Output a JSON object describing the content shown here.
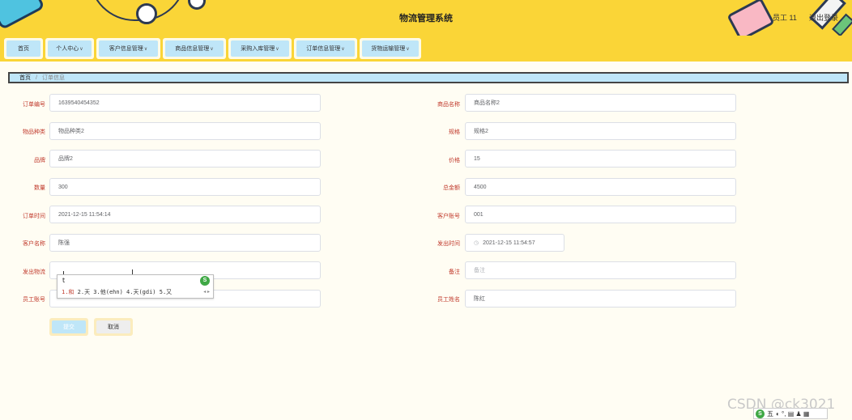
{
  "header": {
    "title": "物流管理系统",
    "user": "员工 11",
    "logout": "退出登录"
  },
  "nav": {
    "items": [
      {
        "label": "首页",
        "has_dropdown": false
      },
      {
        "label": "个人中心",
        "has_dropdown": true
      },
      {
        "label": "客户信息管理",
        "has_dropdown": true
      },
      {
        "label": "商品信息管理",
        "has_dropdown": true
      },
      {
        "label": "采购入库管理",
        "has_dropdown": true
      },
      {
        "label": "订单信息管理",
        "has_dropdown": true
      },
      {
        "label": "货物运输管理",
        "has_dropdown": true
      }
    ]
  },
  "breadcrumb": {
    "home": "首页",
    "separator": "/",
    "current": "订单信息"
  },
  "form": {
    "order_no": {
      "label": "订单编号",
      "value": "1639540454352"
    },
    "product_name": {
      "label": "商品名称",
      "value": "商品名称2"
    },
    "category": {
      "label": "物品种类",
      "value": "物品种类2"
    },
    "spec": {
      "label": "规格",
      "value": "规格2"
    },
    "brand": {
      "label": "品牌",
      "value": "品牌2"
    },
    "price": {
      "label": "价格",
      "value": "15"
    },
    "quantity": {
      "label": "数量",
      "value": "300"
    },
    "total": {
      "label": "总金额",
      "value": "4500"
    },
    "order_time": {
      "label": "订单时间",
      "value": "2021-12-15 11:54:14"
    },
    "customer_no": {
      "label": "客户账号",
      "value": "001"
    },
    "customer_name": {
      "label": "客户名称",
      "value": "陈强"
    },
    "ship_time": {
      "label": "发出时间",
      "value": "2021-12-15 11:54:57"
    },
    "ship_logistics": {
      "label": "发出物流",
      "value": ""
    },
    "remark": {
      "label": "备注",
      "placeholder": "备注"
    },
    "emp_no": {
      "label": "员工账号",
      "value": ""
    },
    "emp_name": {
      "label": "员工姓名",
      "value": "陈红"
    }
  },
  "ime_popup": {
    "composition": "t",
    "candidates_first": "1.和",
    "candidates_rest": " 2.天 3.他(ehn) 4.天(gdi) 5.又",
    "logo": "S"
  },
  "buttons": {
    "submit": "提交",
    "cancel": "取消"
  },
  "watermark": "CSDN @ck3021",
  "ime_toolbar": {
    "logo": "S",
    "mode": "五",
    "tail": "◐ °,  ▤ ♟ ▦"
  },
  "colors": {
    "header_bg": "#fad537",
    "nav_inner": "#bfe6f8",
    "label_red": "#c0392b",
    "page_bg": "#fffdf3"
  }
}
